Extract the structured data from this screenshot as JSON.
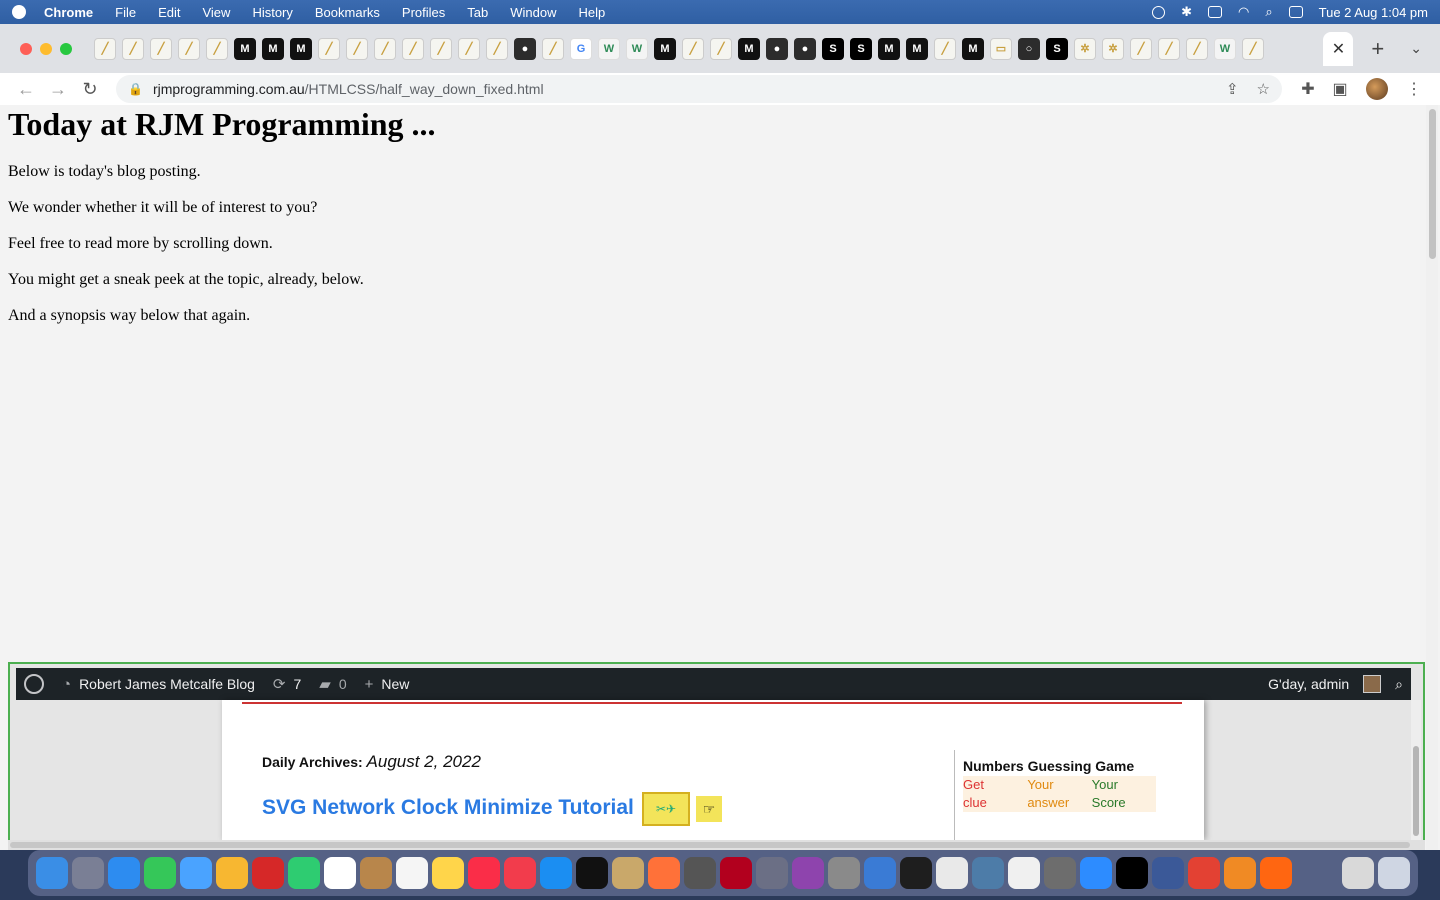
{
  "menubar": {
    "items": [
      "Chrome",
      "File",
      "Edit",
      "View",
      "History",
      "Bookmarks",
      "Profiles",
      "Tab",
      "Window",
      "Help"
    ],
    "clock": "Tue 2 Aug  1:04 pm"
  },
  "browser": {
    "url_host": "rjmprogramming.com.au",
    "url_path": "/HTMLCSS/half_way_down_fixed.html",
    "close_tab": "✕",
    "new_tab": "+"
  },
  "page": {
    "heading": "Today at RJM Programming ...",
    "paragraphs": [
      "Below is today's blog posting.",
      "We wonder whether it will be of interest to you?",
      "Feel free to read more by scrolling down.",
      "You might get a sneak peek at the topic, already, below.",
      "And a synopsis way below that again."
    ]
  },
  "iframe": {
    "adminbar": {
      "site_name": "Robert James Metcalfe Blog",
      "updates_count": "7",
      "comments_count": "0",
      "new_label": "New",
      "greeting": "G'day, admin"
    },
    "archive_label": "Daily Archives:",
    "archive_date": "August 2, 2022",
    "post_title": "SVG Network Clock Minimize Tutorial",
    "widget": {
      "title": "Numbers Guessing Game",
      "col1": [
        "Get",
        "clue"
      ],
      "col2": [
        "Your",
        "answer"
      ],
      "col3": [
        "Your",
        "Score"
      ]
    }
  },
  "colors": {
    "accent_link": "#2a7ae2",
    "iframe_border": "#4caf50",
    "adminbar_bg": "#1d2327"
  }
}
